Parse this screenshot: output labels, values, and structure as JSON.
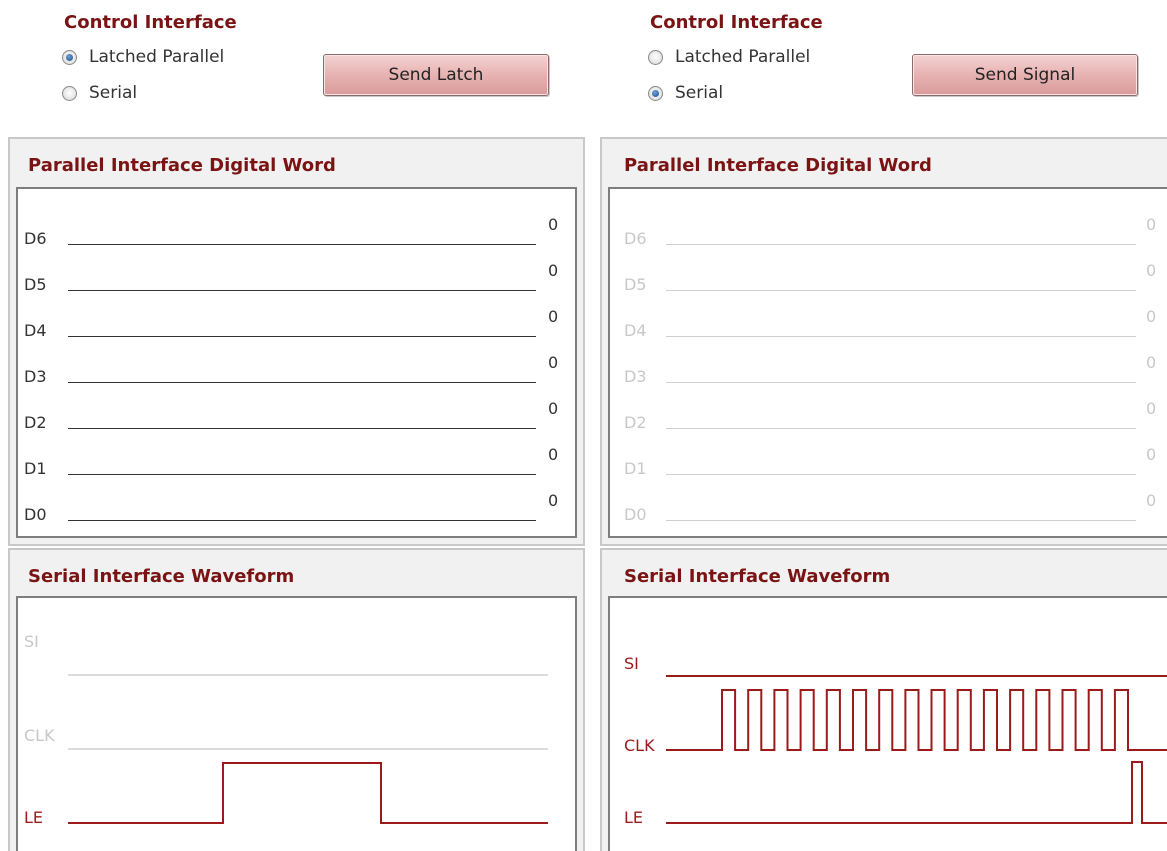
{
  "left": {
    "control": {
      "title": "Control Interface",
      "options": [
        {
          "label": "Latched Parallel",
          "checked": true
        },
        {
          "label": "Serial",
          "checked": false
        }
      ],
      "button_label": "Send Latch"
    },
    "parallel": {
      "title": "Parallel Interface Digital Word",
      "enabled": true,
      "bits": [
        {
          "name": "D6",
          "value": "0"
        },
        {
          "name": "D5",
          "value": "0"
        },
        {
          "name": "D4",
          "value": "0"
        },
        {
          "name": "D3",
          "value": "0"
        },
        {
          "name": "D2",
          "value": "0"
        },
        {
          "name": "D1",
          "value": "0"
        },
        {
          "name": "D0",
          "value": "0"
        }
      ]
    },
    "serial": {
      "title": "Serial Interface Waveform",
      "signals": [
        {
          "name": "SI",
          "active": false
        },
        {
          "name": "CLK",
          "active": false
        },
        {
          "name": "LE",
          "active": true
        }
      ]
    }
  },
  "right": {
    "control": {
      "title": "Control Interface",
      "options": [
        {
          "label": "Latched Parallel",
          "checked": false
        },
        {
          "label": "Serial",
          "checked": true
        }
      ],
      "button_label": "Send Signal"
    },
    "parallel": {
      "title": "Parallel Interface Digital Word",
      "enabled": false,
      "bits": [
        {
          "name": "D6",
          "value": "0"
        },
        {
          "name": "D5",
          "value": "0"
        },
        {
          "name": "D4",
          "value": "0"
        },
        {
          "name": "D3",
          "value": "0"
        },
        {
          "name": "D2",
          "value": "0"
        },
        {
          "name": "D1",
          "value": "0"
        },
        {
          "name": "D0",
          "value": "0"
        }
      ]
    },
    "serial": {
      "title": "Serial Interface Waveform",
      "signals": [
        {
          "name": "SI",
          "active": true
        },
        {
          "name": "CLK",
          "active": true
        },
        {
          "name": "LE",
          "active": true
        }
      ],
      "clk_pulses": 16
    }
  },
  "colors": {
    "title": "#7a1414",
    "waveform": "#9b1a1a",
    "disabled_text": "#c8c8c8",
    "button": "#e3a9a9"
  }
}
